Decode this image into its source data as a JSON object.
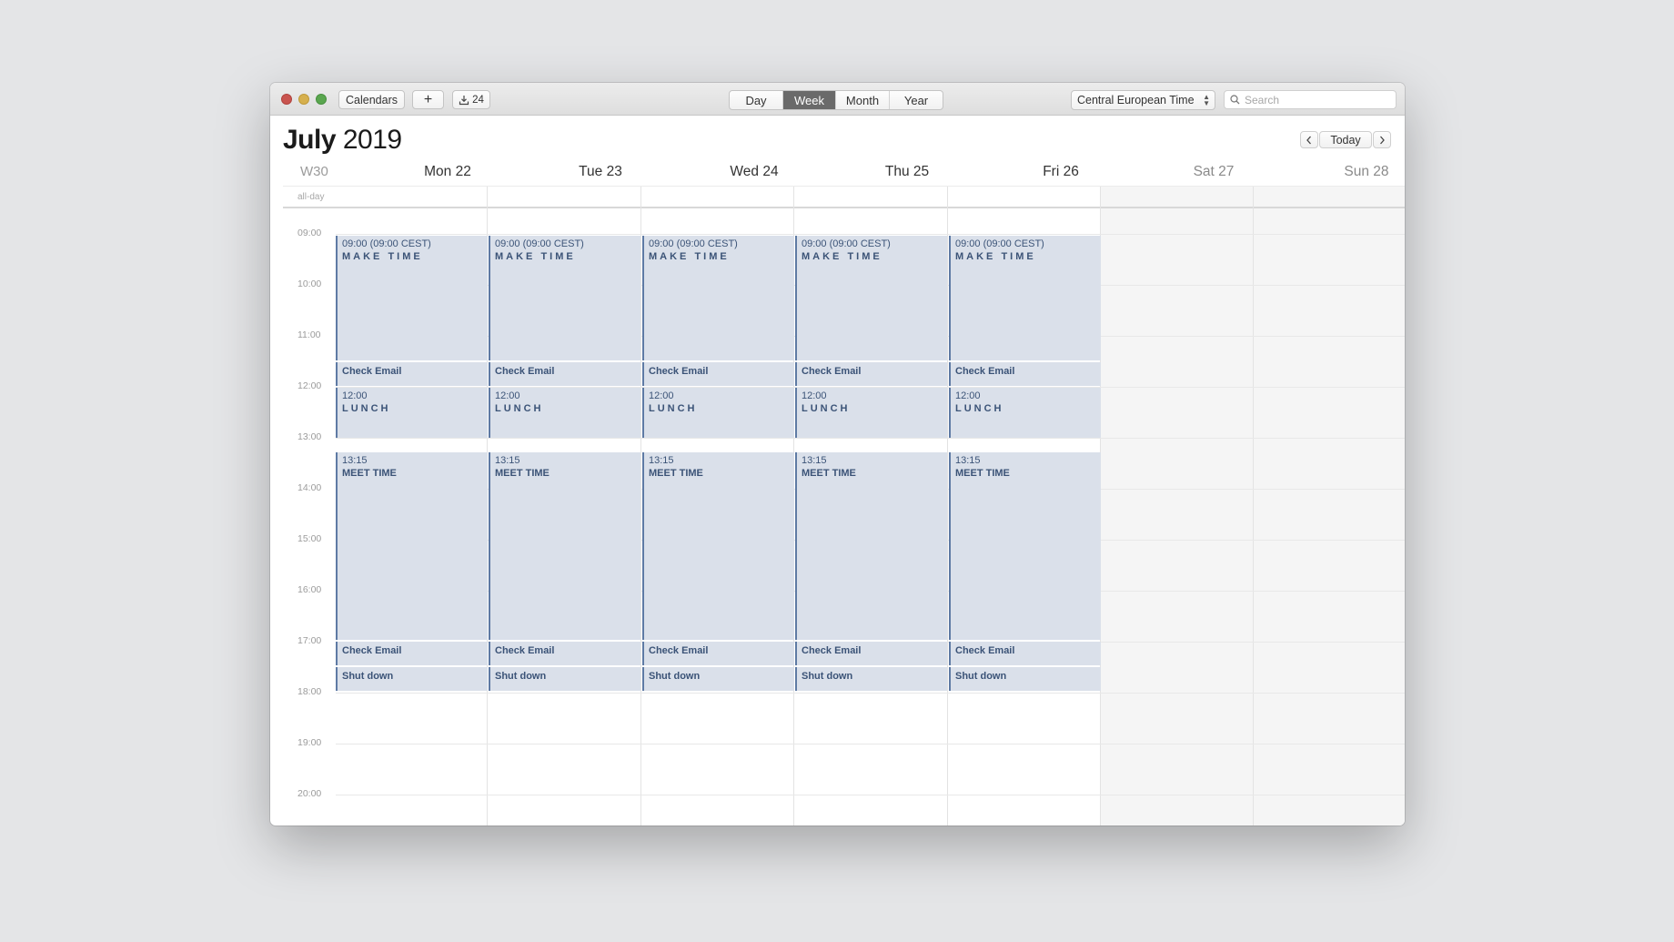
{
  "toolbar": {
    "calendars_label": "Calendars",
    "add_label": "+",
    "inbox_count": "24",
    "views": [
      "Day",
      "Week",
      "Month",
      "Year"
    ],
    "active_view": "Week",
    "timezone": "Central European Time",
    "search_placeholder": "Search"
  },
  "header": {
    "month": "July",
    "year": "2019",
    "today_label": "Today",
    "week_number": "W30",
    "days": [
      "Mon 22",
      "Tue 23",
      "Wed 24",
      "Thu 25",
      "Fri 26",
      "Sat 27",
      "Sun 28"
    ]
  },
  "allday_label": "all-day",
  "hours": [
    "09:00",
    "10:00",
    "11:00",
    "12:00",
    "13:00",
    "14:00",
    "15:00",
    "16:00",
    "17:00",
    "18:00",
    "19:00",
    "20:00"
  ],
  "events": {
    "make_time": {
      "time": "09:00 (09:00 CEST)",
      "title": "MAKE TIME"
    },
    "check_email": {
      "title": "Check Email"
    },
    "lunch": {
      "time": "12:00",
      "title": "LUNCH"
    },
    "meet_time": {
      "time": "13:15",
      "title": "MEET TIME"
    },
    "shut_down": {
      "title": "Shut down"
    }
  },
  "colors": {
    "event_bg": "#dae0ea",
    "event_border": "#5e7aa4",
    "event_text": "#3b5377",
    "active_segment": "#6a6a6a"
  }
}
